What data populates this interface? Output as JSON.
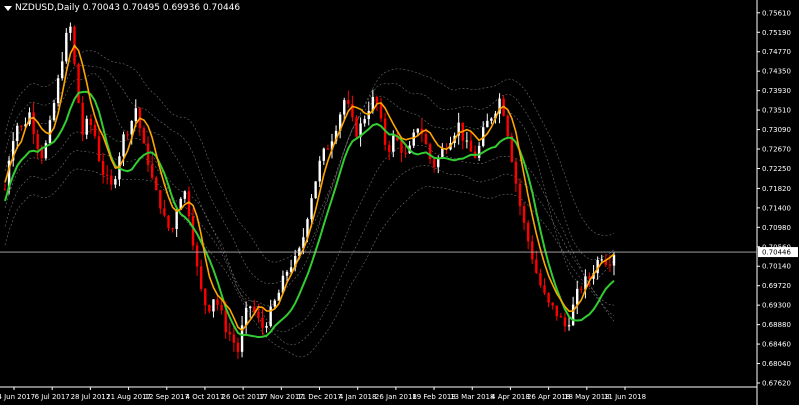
{
  "header": {
    "symbol": "NZDUSD,Daily",
    "ohlc": "0.70043 0.70495 0.69936 0.70446"
  },
  "colors": {
    "background": "#000000",
    "bull": "#ffffff",
    "bear": "#ff0000",
    "fast_line": "#ffa500",
    "slow_line": "#32cd32",
    "envelope": "#8c8c8c",
    "price_line": "#b4b4b4"
  },
  "chart_data": {
    "type": "line",
    "ylim": [
      0.6762,
      0.758
    ],
    "current_price": 0.70446,
    "current_price_label": "0.70446",
    "yticks": [
      {
        "v": 0.7561,
        "label": "0.75610"
      },
      {
        "v": 0.7519,
        "label": "0.75190"
      },
      {
        "v": 0.7477,
        "label": "0.74770"
      },
      {
        "v": 0.7435,
        "label": "0.74350"
      },
      {
        "v": 0.7393,
        "label": "0.73930"
      },
      {
        "v": 0.7351,
        "label": "0.73510"
      },
      {
        "v": 0.7309,
        "label": "0.73090"
      },
      {
        "v": 0.7267,
        "label": "0.72670"
      },
      {
        "v": 0.7225,
        "label": "0.72250"
      },
      {
        "v": 0.7182,
        "label": "0.71820"
      },
      {
        "v": 0.714,
        "label": "0.71400"
      },
      {
        "v": 0.7098,
        "label": "0.70980"
      },
      {
        "v": 0.7056,
        "label": "0.70560"
      },
      {
        "v": 0.7014,
        "label": "0.70140"
      },
      {
        "v": 0.6972,
        "label": "0.69720"
      },
      {
        "v": 0.693,
        "label": "0.69300"
      },
      {
        "v": 0.6888,
        "label": "0.68880"
      },
      {
        "v": 0.6846,
        "label": "0.68460"
      },
      {
        "v": 0.6804,
        "label": "0.68040"
      },
      {
        "v": 0.6762,
        "label": "0.67620"
      }
    ],
    "xtick_labels": [
      "14 Jun 2017",
      "6 Jul 2017",
      "28 Jul 2017",
      "21 Aug 2017",
      "12 Sep 2017",
      "4 Oct 2017",
      "26 Oct 2017",
      "17 Nov 2017",
      "11 Dec 2017",
      "4 Jan 2018",
      "26 Jan 2018",
      "19 Feb 2018",
      "13 Mar 2018",
      "4 Apr 2018",
      "26 Apr 2018",
      "18 May 2018",
      "11 Jun 2018"
    ],
    "price_path": [
      0.718,
      0.728,
      0.732,
      0.731,
      0.735,
      0.73,
      0.725,
      0.728,
      0.735,
      0.742,
      0.75,
      0.753,
      0.74,
      0.73,
      0.733,
      0.73,
      0.723,
      0.72,
      0.718,
      0.725,
      0.73,
      0.732,
      0.736,
      0.728,
      0.724,
      0.718,
      0.715,
      0.71,
      0.709,
      0.716,
      0.718,
      0.712,
      0.702,
      0.695,
      0.692,
      0.695,
      0.692,
      0.688,
      0.686,
      0.683,
      0.69,
      0.693,
      0.691,
      0.688,
      0.69,
      0.693,
      0.696,
      0.7,
      0.702,
      0.703,
      0.708,
      0.715,
      0.72,
      0.725,
      0.727,
      0.73,
      0.734,
      0.738,
      0.733,
      0.73,
      0.733,
      0.736,
      0.738,
      0.732,
      0.726,
      0.729,
      0.728,
      0.725,
      0.727,
      0.732,
      0.73,
      0.725,
      0.723,
      0.726,
      0.728,
      0.73,
      0.732,
      0.728,
      0.726,
      0.725,
      0.73,
      0.733,
      0.735,
      0.738,
      0.732,
      0.724,
      0.716,
      0.71,
      0.705,
      0.7,
      0.696,
      0.693,
      0.692,
      0.69,
      0.688,
      0.692,
      0.696,
      0.698,
      0.699,
      0.702,
      0.704,
      0.702,
      0.7045
    ],
    "series": []
  }
}
